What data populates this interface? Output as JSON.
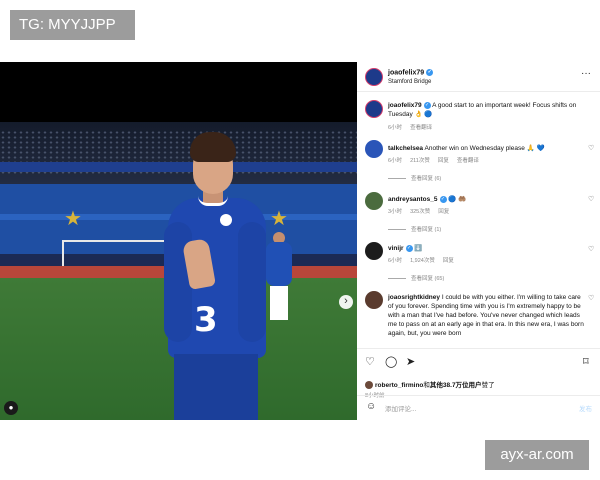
{
  "watermarks": {
    "top": "TG: MYYJJPP",
    "bottom": "ayx-ar.com"
  },
  "post": {
    "author": "joaofelix79",
    "location": "Stamford Bridge",
    "more_icon": "more-horizontal-icon",
    "shirt_number": "3"
  },
  "comments": [
    {
      "user": "joaofelix79",
      "verified": true,
      "text": "A good start to an important week! Focus shifts on Tuesday 👌 🔵",
      "time": "6小时",
      "translate": "查看翻译"
    },
    {
      "user": "talkchelsea",
      "verified": false,
      "text": "Another win on Wednesday please 🙏 💙",
      "time": "6小时",
      "likes": "211次赞",
      "reply": "回复",
      "translate": "查看翻译",
      "view_replies": "查看回复 (6)"
    },
    {
      "user": "andreysantos_5",
      "verified": true,
      "text": "🔵 🤲🏽",
      "time": "3小时",
      "likes": "325次赞",
      "reply": "回复",
      "view_replies": "查看回复 (1)"
    },
    {
      "user": "vinijr",
      "verified": true,
      "text": "⬇️",
      "time": "6小时",
      "likes": "1,924次赞",
      "reply": "回复",
      "view_replies": "查看回复 (65)"
    },
    {
      "user": "joaosrightkidney",
      "verified": false,
      "text": "I could be with you either. I'm willing to take care of you forever. Spending time with you is I'm extremely happy to be with a man that I've had before. You've never changed which leads me to pass on at an early age in that era. In this new era, I was born again, but, you were born"
    }
  ],
  "actions": {
    "like_icon": "heart-icon",
    "comment_icon": "comment-icon",
    "share_icon": "share-icon",
    "save_icon": "bookmark-icon"
  },
  "likes": {
    "user": "roberto_firmino",
    "connector": "和",
    "others": "其他38.7万位用户",
    "suffix": "赞了"
  },
  "posted_ago": "8小时前",
  "add_comment": {
    "placeholder": "添加评论...",
    "post_label": "发布"
  },
  "colors": {
    "chelsea_blue": "#1f48b0",
    "story_ring": "#d23c6b",
    "verified": "#3897f0",
    "post_disabled": "#b6dafc"
  }
}
